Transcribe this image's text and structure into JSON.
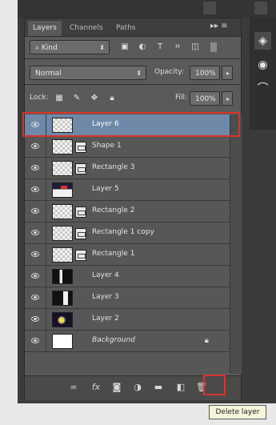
{
  "tabs": [
    {
      "label": "Layers",
      "active": true
    },
    {
      "label": "Channels",
      "active": false
    },
    {
      "label": "Paths",
      "active": false
    }
  ],
  "tab_menu": "▸▸ ≡",
  "filter": {
    "kind_label": "Kind",
    "icons": [
      "image-filter-icon",
      "adjustment-filter-icon",
      "type-filter-icon",
      "shape-filter-icon",
      "smartobject-filter-icon"
    ]
  },
  "blend": {
    "mode": "Normal",
    "opacity_label": "Opacity:",
    "opacity_value": "100%"
  },
  "lock": {
    "label": "Lock:",
    "fill_label": "Fill:",
    "fill_value": "100%"
  },
  "layers": [
    {
      "name": "Layer 6",
      "thumb": "checker",
      "mask": false,
      "selected": true,
      "italic": false
    },
    {
      "name": "Shape 1",
      "thumb": "checker",
      "mask": true,
      "selected": false,
      "italic": false
    },
    {
      "name": "Rectangle 3",
      "thumb": "checker",
      "mask": true,
      "selected": false,
      "italic": false
    },
    {
      "name": "Layer 5",
      "thumb": "flag",
      "mask": false,
      "selected": false,
      "italic": false
    },
    {
      "name": "Rectangle 2",
      "thumb": "checker",
      "mask": true,
      "selected": false,
      "italic": false
    },
    {
      "name": "Rectangle 1 copy",
      "thumb": "checker",
      "mask": true,
      "selected": false,
      "italic": false
    },
    {
      "name": "Rectangle 1",
      "thumb": "checker",
      "mask": true,
      "selected": false,
      "italic": false
    },
    {
      "name": "Layer 4",
      "thumb": "dark",
      "mask": false,
      "selected": false,
      "italic": false
    },
    {
      "name": "Layer 3",
      "thumb": "darkwhite",
      "mask": false,
      "selected": false,
      "italic": false
    },
    {
      "name": "Layer 2",
      "thumb": "photo",
      "mask": false,
      "selected": false,
      "italic": false
    },
    {
      "name": "Background",
      "thumb": "white",
      "mask": false,
      "selected": false,
      "italic": true,
      "locked": true
    }
  ],
  "bottom_icons": [
    "link-layers-icon",
    "fx-icon",
    "add-mask-icon",
    "adjustment-layer-icon",
    "new-group-icon",
    "new-layer-icon",
    "delete-layer-icon"
  ],
  "tooltip": "Delete layer",
  "colors": {
    "highlight": "#d9332b",
    "selected": "#6f88a8"
  }
}
